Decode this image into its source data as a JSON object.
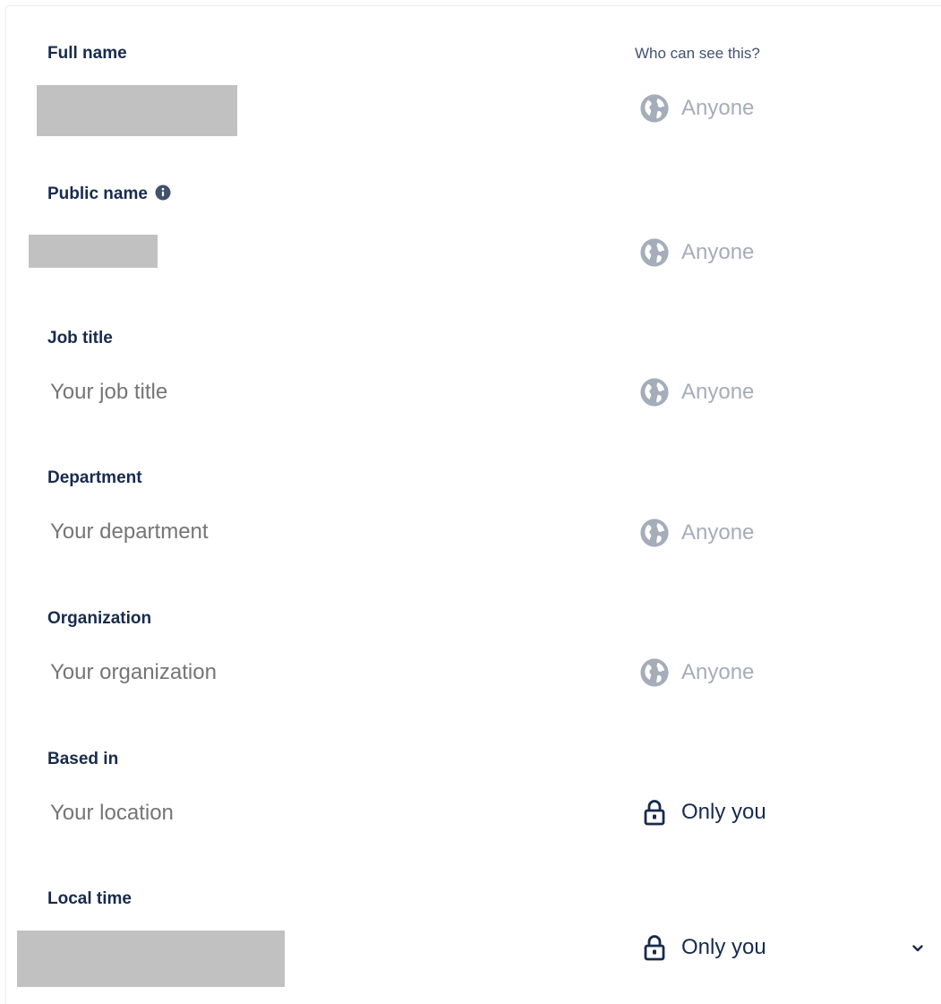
{
  "header": {
    "visibility_title": "Who can see this?"
  },
  "fields": {
    "full_name": {
      "label": "Full name",
      "visibility": "Anyone"
    },
    "public_name": {
      "label": "Public name",
      "visibility": "Anyone"
    },
    "job_title": {
      "label": "Job title",
      "placeholder": "Your job title",
      "visibility": "Anyone"
    },
    "department": {
      "label": "Department",
      "placeholder": "Your department",
      "visibility": "Anyone"
    },
    "organization": {
      "label": "Organization",
      "placeholder": "Your organization",
      "visibility": "Anyone"
    },
    "based_in": {
      "label": "Based in",
      "placeholder": "Your location",
      "visibility": "Only you"
    },
    "local_time": {
      "label": "Local time",
      "visibility": "Only you"
    }
  },
  "icons": {
    "anyone": "globe-icon",
    "only_you": "lock-icon",
    "info": "info-icon",
    "dropdown": "chevron-down-icon"
  },
  "colors": {
    "label_text": "#172b4d",
    "placeholder_text": "#7a869a",
    "anyone_text": "#a5adba",
    "only_you_text": "#172b4d",
    "redacted_block": "#c1c1c1"
  }
}
